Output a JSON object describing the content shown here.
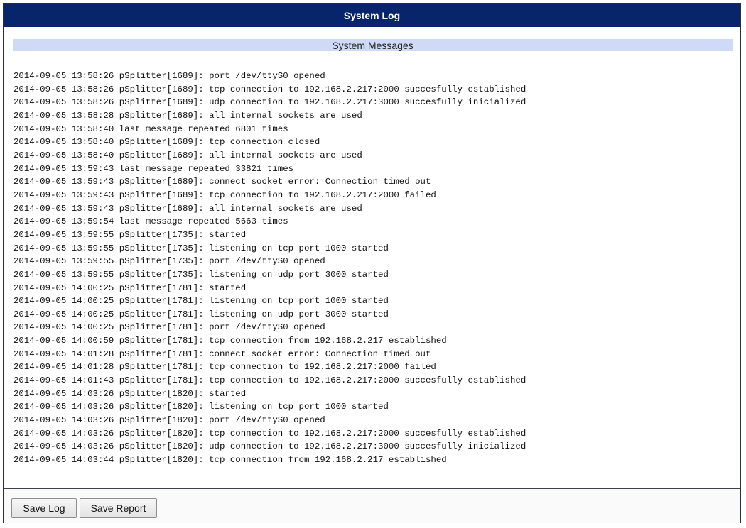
{
  "window": {
    "title": "System Log"
  },
  "section": {
    "title": "System Messages"
  },
  "log_lines": [
    "2014-09-05 13:58:26 pSplitter[1689]: port /dev/ttyS0 opened",
    "2014-09-05 13:58:26 pSplitter[1689]: tcp connection to 192.168.2.217:2000 succesfully established",
    "2014-09-05 13:58:26 pSplitter[1689]: udp connection to 192.168.2.217:3000 succesfully inicialized",
    "2014-09-05 13:58:28 pSplitter[1689]: all internal sockets are used",
    "2014-09-05 13:58:40 last message repeated 6801 times",
    "2014-09-05 13:58:40 pSplitter[1689]: tcp connection closed",
    "2014-09-05 13:58:40 pSplitter[1689]: all internal sockets are used",
    "2014-09-05 13:59:43 last message repeated 33821 times",
    "2014-09-05 13:59:43 pSplitter[1689]: connect socket error: Connection timed out",
    "2014-09-05 13:59:43 pSplitter[1689]: tcp connection to 192.168.2.217:2000 failed",
    "2014-09-05 13:59:43 pSplitter[1689]: all internal sockets are used",
    "2014-09-05 13:59:54 last message repeated 5663 times",
    "2014-09-05 13:59:55 pSplitter[1735]: started",
    "2014-09-05 13:59:55 pSplitter[1735]: listening on tcp port 1000 started",
    "2014-09-05 13:59:55 pSplitter[1735]: port /dev/ttyS0 opened",
    "2014-09-05 13:59:55 pSplitter[1735]: listening on udp port 3000 started",
    "2014-09-05 14:00:25 pSplitter[1781]: started",
    "2014-09-05 14:00:25 pSplitter[1781]: listening on tcp port 1000 started",
    "2014-09-05 14:00:25 pSplitter[1781]: listening on udp port 3000 started",
    "2014-09-05 14:00:25 pSplitter[1781]: port /dev/ttyS0 opened",
    "2014-09-05 14:00:59 pSplitter[1781]: tcp connection from 192.168.2.217 established",
    "2014-09-05 14:01:28 pSplitter[1781]: connect socket error: Connection timed out",
    "2014-09-05 14:01:28 pSplitter[1781]: tcp connection to 192.168.2.217:2000 failed",
    "2014-09-05 14:01:43 pSplitter[1781]: tcp connection to 192.168.2.217:2000 succesfully established",
    "2014-09-05 14:03:26 pSplitter[1820]: started",
    "2014-09-05 14:03:26 pSplitter[1820]: listening on tcp port 1000 started",
    "2014-09-05 14:03:26 pSplitter[1820]: port /dev/ttyS0 opened",
    "2014-09-05 14:03:26 pSplitter[1820]: tcp connection to 192.168.2.217:2000 succesfully established",
    "2014-09-05 14:03:26 pSplitter[1820]: udp connection to 192.168.2.217:3000 succesfully inicialized",
    "2014-09-05 14:03:44 pSplitter[1820]: tcp connection from 192.168.2.217 established"
  ],
  "footer": {
    "save_log_label": "Save Log",
    "save_report_label": "Save Report"
  },
  "colors": {
    "titlebar": "#08246b",
    "section_header": "#cfdaf7"
  }
}
